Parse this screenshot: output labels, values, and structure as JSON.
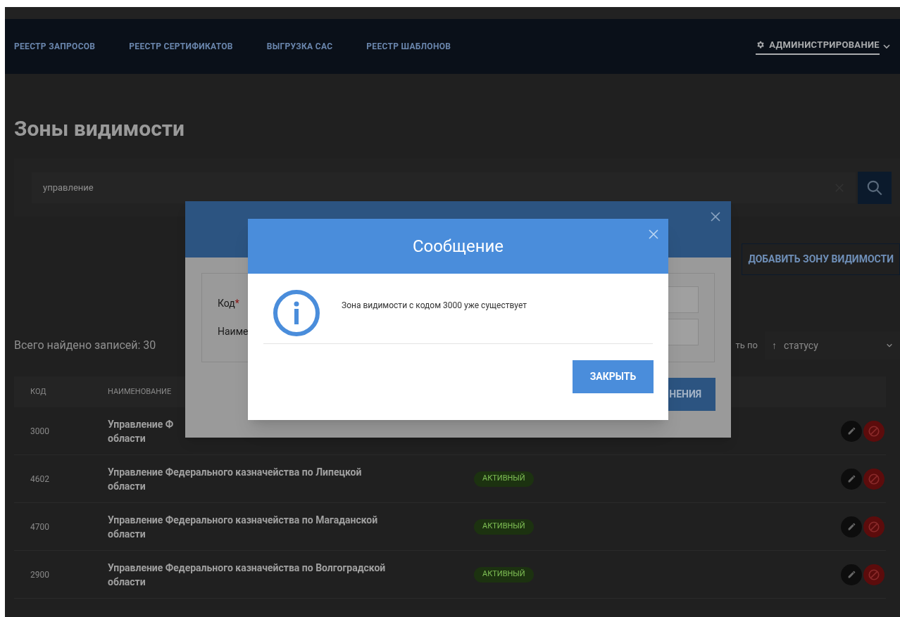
{
  "nav": {
    "items": [
      {
        "label": "РЕЕСТР ЗАПРОСОВ",
        "selected": false
      },
      {
        "label": "РЕЕСТР СЕРТИФИКАТОВ",
        "selected": false
      },
      {
        "label": "ВЫГРУЗКА САС",
        "selected": false
      },
      {
        "label": "РЕЕСТР ШАБЛОНОВ",
        "selected": false
      },
      {
        "label": "АДМИНИСТРИРОВАНИЕ",
        "selected": true
      }
    ]
  },
  "page_title": "Зоны видимости",
  "search": {
    "value": "управление"
  },
  "add_button": "ДОБАВИТЬ ЗОНУ ВИДИМОСТИ",
  "total": "Всего найдено записей: 30",
  "sort": {
    "label": "ть по",
    "arrow": "↑",
    "value": "статусу"
  },
  "table": {
    "columns": [
      "КОД",
      "НАИМЕНОВАНИЕ"
    ],
    "rows": [
      {
        "code": "3000",
        "name_lines": [
          "Управление Ф",
          "области"
        ]
      },
      {
        "code": "4602",
        "name_lines": [
          "Управление Федерального казначейства по Липецкой",
          "области"
        ],
        "status": "АКТИВНЫЙ"
      },
      {
        "code": "4700",
        "name_lines": [
          "Управление Федерального казначейства по Магаданской",
          "области"
        ],
        "status": "АКТИВНЫЙ"
      },
      {
        "code": "2900",
        "name_lines": [
          "Управление Федерального казначейства по Волгоградской",
          "области"
        ],
        "status": "АКТИВНЫЙ"
      }
    ]
  },
  "edit_dialog": {
    "fields": [
      {
        "label": "Код",
        "mark": "*"
      },
      {
        "label": "Наиме"
      }
    ],
    "button": "НЕНИЯ"
  },
  "message_dialog": {
    "title": "Сообщение",
    "text": "Зона видимости с кодом 3000 уже существует",
    "button": "ЗАКРЫТЬ"
  }
}
